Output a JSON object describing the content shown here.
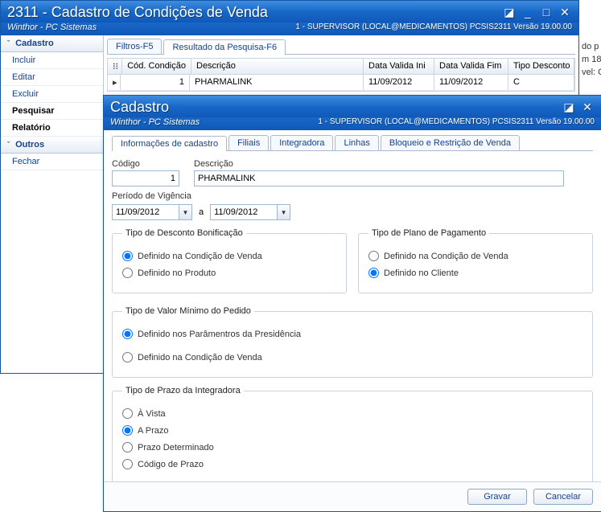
{
  "main_window": {
    "title": "2311 - Cadastro de Condições de Venda",
    "subtitle_left": "Winthor - PC Sistemas",
    "subtitle_right": "1 - SUPERVISOR (LOCAL@MEDICAMENTOS)   PCSIS2311   Versão 19.00.00",
    "tabs": {
      "filtros": "Filtros-F5",
      "resultado": "Resultado da Pesquisa-F6"
    },
    "sidebar": {
      "cadastro_header": "Cadastro",
      "items": [
        "Incluir",
        "Editar",
        "Excluir",
        "Pesquisar",
        "Relatório"
      ],
      "outros_header": "Outros",
      "outros_items": [
        "Fechar"
      ]
    },
    "grid_headers": {
      "cod": "Cód. Condição",
      "desc": "Descrição",
      "dvi": "Data Valida Ini",
      "dvf": "Data Valida Fim",
      "td": "Tipo Desconto"
    },
    "grid_row": {
      "cod": "1",
      "desc": "PHARMALINK",
      "dvi": "11/09/2012",
      "dvf": "11/09/2012",
      "td": "C"
    }
  },
  "cadastro_window": {
    "title": "Cadastro",
    "subtitle_left": "Winthor - PC Sistemas",
    "subtitle_right": "1 - SUPERVISOR (LOCAL@MEDICAMENTOS)   PCSIS2311   Versão 19.00.00",
    "tabs": {
      "info": "Informações de cadastro",
      "filiais": "Filiais",
      "integradora": "Integradora",
      "linhas": "Linhas",
      "bloqueio": "Bloqueio e Restrição de Venda"
    },
    "labels": {
      "codigo": "Código",
      "descricao": "Descrição",
      "periodo": "Período de Vigência",
      "a": "a"
    },
    "values": {
      "codigo": "1",
      "descricao": "PHARMALINK",
      "data_ini": "11/09/2012",
      "data_fim": "11/09/2012"
    },
    "group_tipo_desconto": {
      "legend": "Tipo de Desconto Bonificação",
      "opt1": "Definido na Condição de Venda",
      "opt2": "Definido no Produto"
    },
    "group_tipo_plano": {
      "legend": "Tipo de Plano de Pagamento",
      "opt1": "Definido na Condição de Venda",
      "opt2": "Definido no Cliente"
    },
    "group_tipo_valor_min": {
      "legend": "Tipo de Valor Mínimo do Pedido",
      "opt1": "Definido nos Parâmentros da Presidência",
      "opt2": "Definido na Condição  de Venda"
    },
    "group_tipo_prazo": {
      "legend": "Tipo de Prazo da Integradora",
      "opt1": "À Vista",
      "opt2": "A Prazo",
      "opt3": "Prazo Determinado",
      "opt4": "Código de Prazo"
    },
    "buttons": {
      "gravar": "Gravar",
      "cancelar": "Cancelar"
    }
  }
}
